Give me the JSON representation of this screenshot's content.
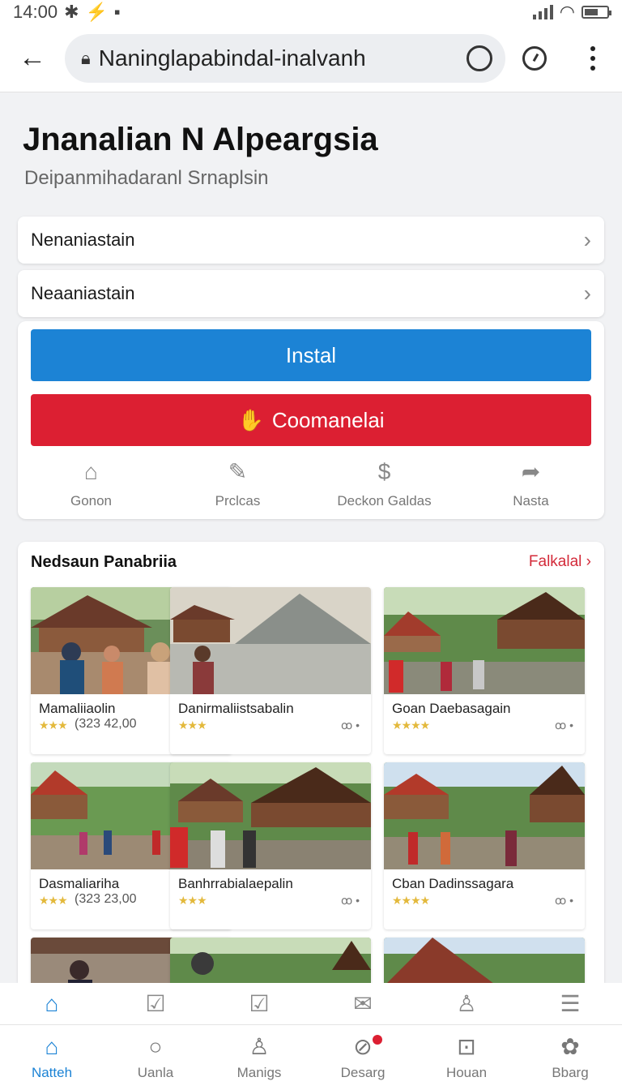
{
  "status": {
    "time": "14:00",
    "icons": [
      "gear-icon",
      "sync-icon",
      "sim-icon"
    ]
  },
  "browser": {
    "url": "Naninglapabindal-inalvanh"
  },
  "page": {
    "title": "Jnanalian N Alpeargsia",
    "subtitle": "Deipanmihadaranl Srnaplsin"
  },
  "rows": [
    {
      "label": "Nenaniastain"
    },
    {
      "label": "Neaaniastain"
    }
  ],
  "actions": {
    "install_label": "Instal",
    "red_label": "Coomanelai",
    "quick": [
      {
        "label": "Gonon",
        "icon": "⌂"
      },
      {
        "label": "Prclcas",
        "icon": "✎"
      },
      {
        "label": "Deckon Galdas",
        "icon": "$"
      },
      {
        "label": "Nasta",
        "icon": "➦"
      }
    ]
  },
  "recommendations": {
    "title": "Nedsaun Panabriia",
    "more_label": "Falkalal",
    "items": [
      {
        "name": "Mamaliiaolin",
        "stars": "★★★",
        "meta": "(323 42,00",
        "icon": "•"
      },
      {
        "name": "Danirmaliistsabalin",
        "stars": "★★★",
        "meta": "",
        "icon": "ꝏ •"
      },
      {
        "name": "Goan Daebasagain",
        "stars": "★★★★",
        "meta": "",
        "icon": "ꝏ •"
      },
      {
        "name": "Dasmaliariha",
        "stars": "★★★",
        "meta": "(323 23,00",
        "icon": "•"
      },
      {
        "name": "Banhrrabialaepalin",
        "stars": "★★★",
        "meta": "",
        "icon": "ꝏ •"
      },
      {
        "name": "Cban Dadinssagara",
        "stars": "★★★★",
        "meta": "",
        "icon": "ꝏ •"
      }
    ]
  },
  "tabs_top": [
    "home-icon",
    "chat-icon",
    "check-icon",
    "mail-icon",
    "user-icon",
    "menu-icon"
  ],
  "tabs_bottom": [
    {
      "label": "Natteh",
      "icon": "⌂"
    },
    {
      "label": "Uanla",
      "icon": "○"
    },
    {
      "label": "Manigs",
      "icon": "♙"
    },
    {
      "label": "Desarg",
      "icon": "⊘"
    },
    {
      "label": "Houan",
      "icon": "⊡"
    },
    {
      "label": "Bbarg",
      "icon": "✿"
    }
  ],
  "colors": {
    "accent": "#1c83d5",
    "danger": "#dc1f32",
    "stars": "#e3b93c"
  }
}
